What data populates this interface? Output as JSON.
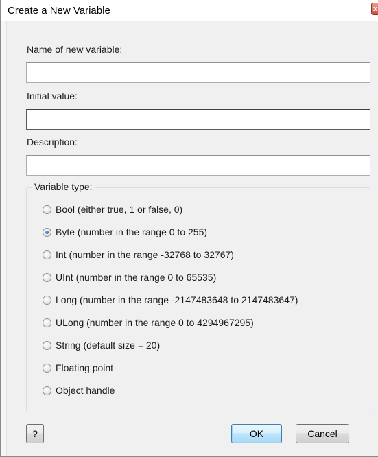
{
  "window": {
    "title": "Create a New Variable",
    "close_glyph": "x"
  },
  "fields": {
    "name_label": "Name of new variable:",
    "name_value": "",
    "initial_label": "Initial value:",
    "initial_value": "",
    "description_label": "Description:",
    "description_value": ""
  },
  "variable_type": {
    "legend": "Variable type:",
    "selected_index": 1,
    "options": [
      "Bool (either true, 1 or false, 0)",
      "Byte (number in the range 0 to 255)",
      "Int (number in the range -32768 to 32767)",
      "UInt (number in the range 0 to 65535)",
      "Long (number in the range -2147483648 to 2147483647)",
      "ULong (number in the range 0 to 4294967295)",
      "String (default size = 20)",
      "Floating point",
      "Object handle"
    ]
  },
  "buttons": {
    "help": "?",
    "ok": "OK",
    "cancel": "Cancel"
  },
  "colors": {
    "accent": "#3c7fb1",
    "dialog_bg": "#f0f0f0"
  }
}
